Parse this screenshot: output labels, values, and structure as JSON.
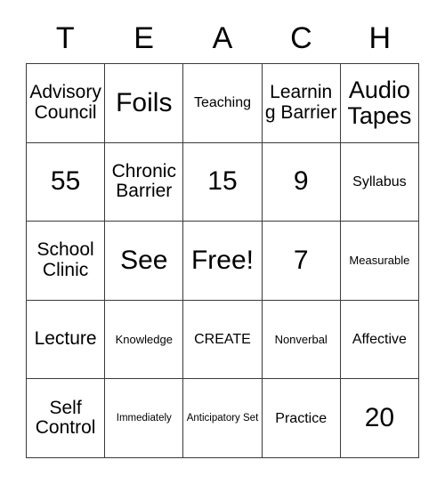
{
  "card": {
    "title_letters": [
      "T",
      "E",
      "A",
      "C",
      "H"
    ],
    "grid_size": "5x5",
    "free_space_label": "Free!",
    "colors": {
      "background": "#ffffff",
      "grid_line": "#3a3a3a",
      "text": "#000000"
    },
    "rows": [
      [
        {
          "label": "Advisory Council",
          "size": "md"
        },
        {
          "label": "Foils",
          "size": "xl"
        },
        {
          "label": "Teaching",
          "size": "sm"
        },
        {
          "label": "Learning Barrier",
          "size": "md"
        },
        {
          "label": "Audio Tapes",
          "size": "lg"
        }
      ],
      [
        {
          "label": "55",
          "size": "xl"
        },
        {
          "label": "Chronic Barrier",
          "size": "md"
        },
        {
          "label": "15",
          "size": "xl"
        },
        {
          "label": "9",
          "size": "xl"
        },
        {
          "label": "Syllabus",
          "size": "sm"
        }
      ],
      [
        {
          "label": "School Clinic",
          "size": "md"
        },
        {
          "label": "See",
          "size": "xl"
        },
        {
          "label": "Free!",
          "size": "xl"
        },
        {
          "label": "7",
          "size": "xl"
        },
        {
          "label": "Measurable",
          "size": "xs"
        }
      ],
      [
        {
          "label": "Lecture",
          "size": "md"
        },
        {
          "label": "Knowledge",
          "size": "xs"
        },
        {
          "label": "CREATE",
          "size": "sm"
        },
        {
          "label": "Nonverbal",
          "size": "xs"
        },
        {
          "label": "Affective",
          "size": "sm"
        }
      ],
      [
        {
          "label": "Self Control",
          "size": "md"
        },
        {
          "label": "Immediately",
          "size": "xxs"
        },
        {
          "label": "Anticipatory Set",
          "size": "xxs"
        },
        {
          "label": "Practice",
          "size": "sm"
        },
        {
          "label": "20",
          "size": "xl"
        }
      ]
    ]
  }
}
